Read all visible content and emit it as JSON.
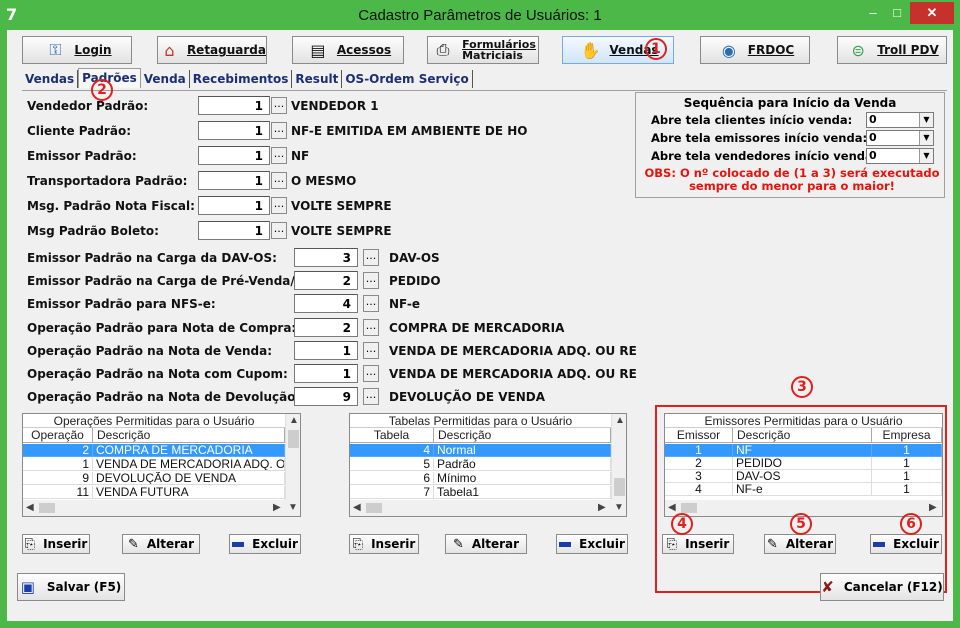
{
  "window": {
    "title": "Cadastro Parâmetros de Usuários: 1",
    "app_icon": "7",
    "min": "–",
    "max": "□",
    "close": "✕"
  },
  "toolbar": [
    {
      "name": "login",
      "label": "Login",
      "icon": "keys-icon",
      "glyph": "⚿"
    },
    {
      "name": "retaguarda",
      "label": "Retaguarda",
      "icon": "roof-icon",
      "glyph": "⌂"
    },
    {
      "name": "acessos",
      "label": "Acessos",
      "icon": "clipboard-icon",
      "glyph": "▤"
    },
    {
      "name": "formularios",
      "label": "Formulários",
      "label2": "Matriciais",
      "icon": "printer-icon",
      "glyph": "⎙"
    },
    {
      "name": "vendas",
      "label": "Vendas",
      "icon": "hand-icon",
      "glyph": "✋"
    },
    {
      "name": "frdoc",
      "label": "FRDOC",
      "icon": "globe-monitor-icon",
      "glyph": "◉"
    },
    {
      "name": "troll",
      "label": "Troll PDV",
      "icon": "green-circle-icon",
      "glyph": "⊜"
    }
  ],
  "tabs": [
    "Vendas",
    "Padrões",
    "Venda",
    "Recebimentos",
    "Result",
    "OS-Ordem Serviço"
  ],
  "fields_top": [
    {
      "label": "Vendedor Padrão:",
      "value": "1",
      "desc": "VENDEDOR 1"
    },
    {
      "label": "Cliente Padrão:",
      "value": "1",
      "desc": "NF-E EMITIDA EM AMBIENTE DE HO"
    },
    {
      "label": "Emissor Padrão:",
      "value": "1",
      "desc": "NF"
    },
    {
      "label": "Transportadora Padrão:",
      "value": "1",
      "desc": "O MESMO"
    },
    {
      "label": "Msg. Padrão Nota Fiscal:",
      "value": "1",
      "desc": "VOLTE SEMPRE"
    },
    {
      "label": "Msg Padrão Boleto:",
      "value": "1",
      "desc": "VOLTE SEMPRE"
    }
  ],
  "fields_bottom": [
    {
      "label": "Emissor Padrão na Carga da DAV-OS:",
      "value": "3",
      "desc": "DAV-OS"
    },
    {
      "label": "Emissor Padrão na Carga de Pré-Venda/DAV:",
      "value": "2",
      "desc": "PEDIDO"
    },
    {
      "label": "Emissor Padrão para NFS-e:",
      "value": "4",
      "desc": "NF-e"
    },
    {
      "label": "Operação Padrão para Nota de Compra:",
      "value": "2",
      "desc": "COMPRA DE MERCADORIA"
    },
    {
      "label": "Operação Padrão na Nota de Venda:",
      "value": "1",
      "desc": "VENDA DE MERCADORIA ADQ. OU RE"
    },
    {
      "label": "Operação Padrão na Nota com Cupom:",
      "value": "1",
      "desc": "VENDA DE MERCADORIA ADQ. OU RE"
    },
    {
      "label": "Operação Padrão na Nota de Devolução:",
      "value": "9",
      "desc": "DEVOLUÇÃO DE VENDA"
    }
  ],
  "sequence": {
    "title": "Sequência para Início da Venda",
    "rows": [
      {
        "label": "Abre tela clientes início venda:",
        "value": "0"
      },
      {
        "label": "Abre tela emissores início venda:",
        "value": "0"
      },
      {
        "label": "Abre tela vendedores início venda:",
        "value": "0"
      }
    ],
    "obs_line1": "OBS: O nº  colocado de (1 a 3) será executado",
    "obs_line2": "sempre do menor para o maior!"
  },
  "grid_operacoes": {
    "title": "Operações Permitidas para o Usuário",
    "headers": [
      "Operação",
      "Descrição"
    ],
    "rows": [
      [
        "2",
        "COMPRA DE MERCADORIA"
      ],
      [
        "1",
        "VENDA DE MERCADORIA ADQ. OU R"
      ],
      [
        "9",
        "DEVOLUÇÃO DE VENDA"
      ],
      [
        "11",
        "VENDA FUTURA"
      ]
    ],
    "selected": 0
  },
  "grid_tabelas": {
    "title": "Tabelas Permitidas para o Usuário",
    "headers": [
      "Tabela",
      "Descrição"
    ],
    "rows": [
      [
        "4",
        "Normal"
      ],
      [
        "5",
        "Padrão"
      ],
      [
        "6",
        "Mínimo"
      ],
      [
        "7",
        "Tabela1"
      ]
    ],
    "selected": 0
  },
  "grid_emissores": {
    "title": "Emissores Permitidas para o Usuário",
    "headers": [
      "Emissor",
      "Descrição",
      "Empresa"
    ],
    "rows": [
      [
        "1",
        "NF",
        "1"
      ],
      [
        "2",
        "PEDIDO",
        "1"
      ],
      [
        "3",
        "DAV-OS",
        "1"
      ],
      [
        "4",
        "NF-e",
        "1"
      ]
    ],
    "selected": 0
  },
  "grid_buttons": {
    "insert": "Inserir",
    "edit": "Alterar",
    "delete": "Excluir"
  },
  "bottom": {
    "save": "Salvar (F5)",
    "cancel": "Cancelar (F12)"
  },
  "badges": [
    "1",
    "2",
    "3",
    "4",
    "5",
    "6"
  ],
  "colors": {
    "titlebar": "#4cb847",
    "selection": "#3399ff",
    "annotation": "#e0201c",
    "obs": "#e8120c"
  }
}
